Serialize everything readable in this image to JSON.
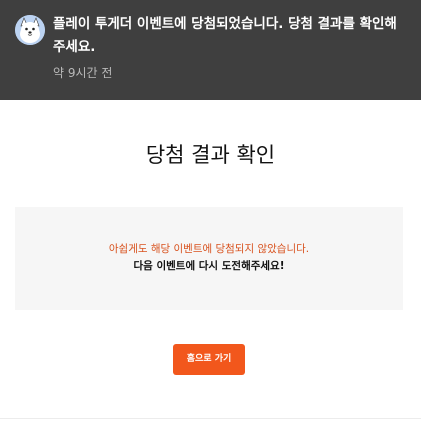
{
  "notification": {
    "avatar_icon": "dog-mascot-avatar-icon",
    "message": "플레이 투게더 이벤트에 당첨되었습니다. 당첨 결과를 확인해 주세요.",
    "time": "약 9시간 전"
  },
  "result": {
    "title": "당첨 결과 확인",
    "line1": "아쉽게도 해당 이벤트에 당첨되지 않았습니다.",
    "line2": "다음 이벤트에 다시 도전해주세요!"
  },
  "actions": {
    "home_label": "홈으로 가기"
  },
  "colors": {
    "notification_bg": "#3f3f3f",
    "accent": "#f2571c",
    "warning_text": "#d8521e"
  }
}
